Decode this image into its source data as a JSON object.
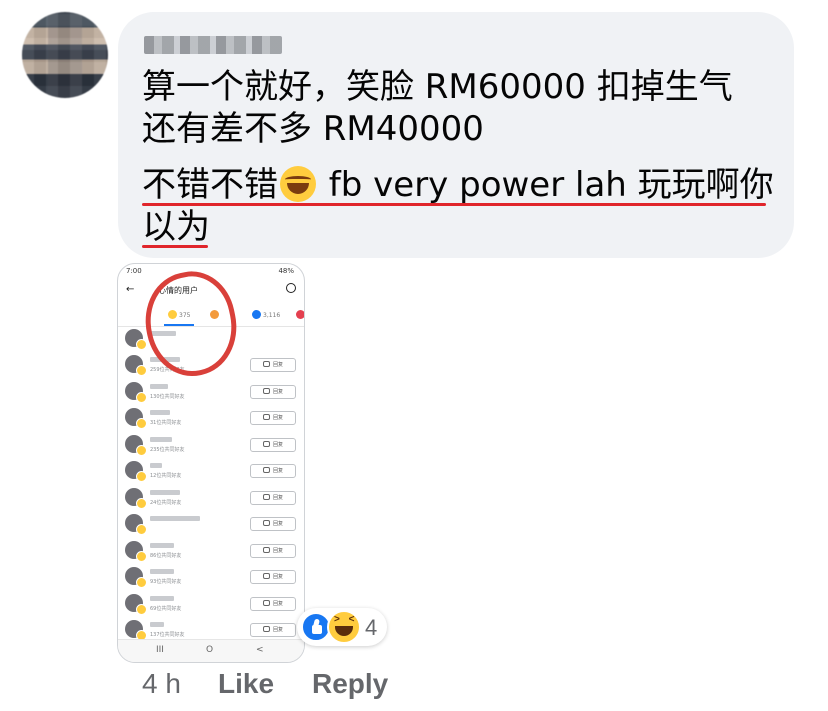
{
  "comment": {
    "lines": [
      "算一个就好，笑脸 RM60000 扣掉生气",
      "还有差不多 RM40000",
      "不错不错",
      " fb very power lah 玩玩啊你",
      "以为"
    ],
    "emoji": "joy-emoji"
  },
  "screenshot": {
    "status_time": "7:00",
    "battery": "48%",
    "title": "心情的用户",
    "tabs": [
      "",
      "375",
      "",
      "3,116"
    ],
    "rows": [
      {
        "sub": "259位共同好友",
        "btn": "回复"
      },
      {
        "sub": "130位共同好友",
        "btn": "回复"
      },
      {
        "sub": "31位共同好友",
        "btn": "回复"
      },
      {
        "sub": "235位共同好友",
        "btn": "回复"
      },
      {
        "sub": "12位共同好友",
        "btn": "回复"
      },
      {
        "sub": "24位共同好友",
        "btn": "回复"
      },
      {
        "sub": "",
        "btn": "回复"
      },
      {
        "sub": "86位共同好友",
        "btn": "回复"
      },
      {
        "sub": "93位共同好友",
        "btn": "回复"
      },
      {
        "sub": "69位共同好友",
        "btn": "回复"
      },
      {
        "sub": "137位共同好友",
        "btn": "回复"
      }
    ],
    "nav": [
      "III",
      "O",
      "<"
    ]
  },
  "reactions": {
    "count": "4",
    "icons": [
      "like-icon",
      "haha-icon"
    ]
  },
  "footer": {
    "time": "4 h",
    "like": "Like",
    "reply": "Reply"
  },
  "colors": {
    "bubble": "#f0f2f5",
    "underline": "#e0252b",
    "like_blue": "#1877f2",
    "circle": "#d9403a"
  }
}
